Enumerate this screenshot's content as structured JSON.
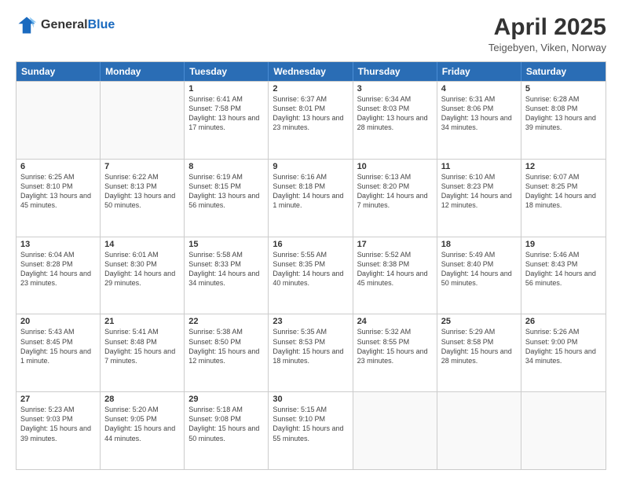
{
  "header": {
    "logo_general": "General",
    "logo_blue": "Blue",
    "month_title": "April 2025",
    "location": "Teigebyen, Viken, Norway"
  },
  "days_of_week": [
    "Sunday",
    "Monday",
    "Tuesday",
    "Wednesday",
    "Thursday",
    "Friday",
    "Saturday"
  ],
  "weeks": [
    [
      {
        "day": "",
        "info": ""
      },
      {
        "day": "",
        "info": ""
      },
      {
        "day": "1",
        "info": "Sunrise: 6:41 AM\nSunset: 7:58 PM\nDaylight: 13 hours and 17 minutes."
      },
      {
        "day": "2",
        "info": "Sunrise: 6:37 AM\nSunset: 8:01 PM\nDaylight: 13 hours and 23 minutes."
      },
      {
        "day": "3",
        "info": "Sunrise: 6:34 AM\nSunset: 8:03 PM\nDaylight: 13 hours and 28 minutes."
      },
      {
        "day": "4",
        "info": "Sunrise: 6:31 AM\nSunset: 8:06 PM\nDaylight: 13 hours and 34 minutes."
      },
      {
        "day": "5",
        "info": "Sunrise: 6:28 AM\nSunset: 8:08 PM\nDaylight: 13 hours and 39 minutes."
      }
    ],
    [
      {
        "day": "6",
        "info": "Sunrise: 6:25 AM\nSunset: 8:10 PM\nDaylight: 13 hours and 45 minutes."
      },
      {
        "day": "7",
        "info": "Sunrise: 6:22 AM\nSunset: 8:13 PM\nDaylight: 13 hours and 50 minutes."
      },
      {
        "day": "8",
        "info": "Sunrise: 6:19 AM\nSunset: 8:15 PM\nDaylight: 13 hours and 56 minutes."
      },
      {
        "day": "9",
        "info": "Sunrise: 6:16 AM\nSunset: 8:18 PM\nDaylight: 14 hours and 1 minute."
      },
      {
        "day": "10",
        "info": "Sunrise: 6:13 AM\nSunset: 8:20 PM\nDaylight: 14 hours and 7 minutes."
      },
      {
        "day": "11",
        "info": "Sunrise: 6:10 AM\nSunset: 8:23 PM\nDaylight: 14 hours and 12 minutes."
      },
      {
        "day": "12",
        "info": "Sunrise: 6:07 AM\nSunset: 8:25 PM\nDaylight: 14 hours and 18 minutes."
      }
    ],
    [
      {
        "day": "13",
        "info": "Sunrise: 6:04 AM\nSunset: 8:28 PM\nDaylight: 14 hours and 23 minutes."
      },
      {
        "day": "14",
        "info": "Sunrise: 6:01 AM\nSunset: 8:30 PM\nDaylight: 14 hours and 29 minutes."
      },
      {
        "day": "15",
        "info": "Sunrise: 5:58 AM\nSunset: 8:33 PM\nDaylight: 14 hours and 34 minutes."
      },
      {
        "day": "16",
        "info": "Sunrise: 5:55 AM\nSunset: 8:35 PM\nDaylight: 14 hours and 40 minutes."
      },
      {
        "day": "17",
        "info": "Sunrise: 5:52 AM\nSunset: 8:38 PM\nDaylight: 14 hours and 45 minutes."
      },
      {
        "day": "18",
        "info": "Sunrise: 5:49 AM\nSunset: 8:40 PM\nDaylight: 14 hours and 50 minutes."
      },
      {
        "day": "19",
        "info": "Sunrise: 5:46 AM\nSunset: 8:43 PM\nDaylight: 14 hours and 56 minutes."
      }
    ],
    [
      {
        "day": "20",
        "info": "Sunrise: 5:43 AM\nSunset: 8:45 PM\nDaylight: 15 hours and 1 minute."
      },
      {
        "day": "21",
        "info": "Sunrise: 5:41 AM\nSunset: 8:48 PM\nDaylight: 15 hours and 7 minutes."
      },
      {
        "day": "22",
        "info": "Sunrise: 5:38 AM\nSunset: 8:50 PM\nDaylight: 15 hours and 12 minutes."
      },
      {
        "day": "23",
        "info": "Sunrise: 5:35 AM\nSunset: 8:53 PM\nDaylight: 15 hours and 18 minutes."
      },
      {
        "day": "24",
        "info": "Sunrise: 5:32 AM\nSunset: 8:55 PM\nDaylight: 15 hours and 23 minutes."
      },
      {
        "day": "25",
        "info": "Sunrise: 5:29 AM\nSunset: 8:58 PM\nDaylight: 15 hours and 28 minutes."
      },
      {
        "day": "26",
        "info": "Sunrise: 5:26 AM\nSunset: 9:00 PM\nDaylight: 15 hours and 34 minutes."
      }
    ],
    [
      {
        "day": "27",
        "info": "Sunrise: 5:23 AM\nSunset: 9:03 PM\nDaylight: 15 hours and 39 minutes."
      },
      {
        "day": "28",
        "info": "Sunrise: 5:20 AM\nSunset: 9:05 PM\nDaylight: 15 hours and 44 minutes."
      },
      {
        "day": "29",
        "info": "Sunrise: 5:18 AM\nSunset: 9:08 PM\nDaylight: 15 hours and 50 minutes."
      },
      {
        "day": "30",
        "info": "Sunrise: 5:15 AM\nSunset: 9:10 PM\nDaylight: 15 hours and 55 minutes."
      },
      {
        "day": "",
        "info": ""
      },
      {
        "day": "",
        "info": ""
      },
      {
        "day": "",
        "info": ""
      }
    ]
  ]
}
